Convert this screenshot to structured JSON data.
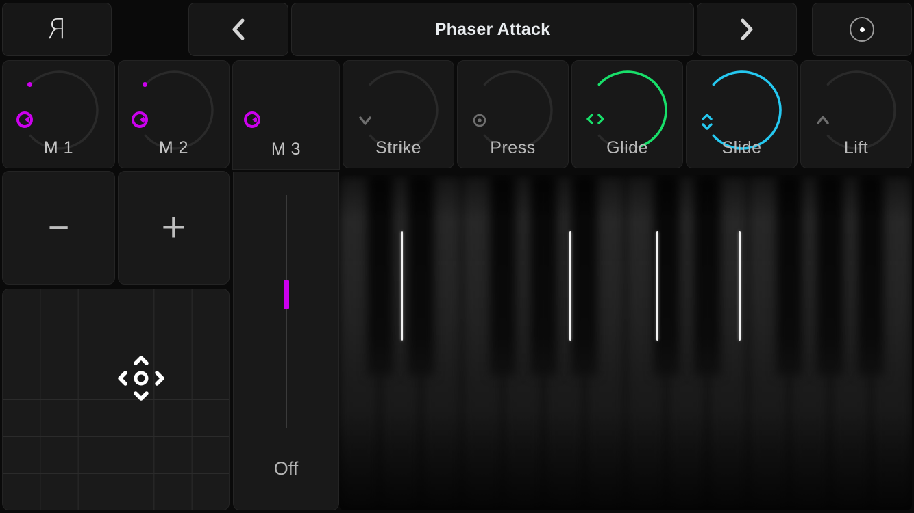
{
  "header": {
    "logo": "R",
    "logo_icon": "roli-logo-icon",
    "prev_label": "‹",
    "prev_icon": "chevron-left-icon",
    "title": "Phaser Attack",
    "next_label": "›",
    "next_icon": "chevron-right-icon",
    "record_icon": "record-circle-icon"
  },
  "knobs": [
    {
      "id": "macro-1",
      "label": "M 1",
      "icon": "knob-dial-icon",
      "color": "#cc00ee",
      "value": 0,
      "arc_color": "#2e2e2e",
      "has_arc": true,
      "has_start_dot": true
    },
    {
      "id": "macro-2",
      "label": "M 2",
      "icon": "knob-dial-icon",
      "color": "#cc00ee",
      "value": 0,
      "arc_color": "#2e2e2e",
      "has_arc": true,
      "has_start_dot": true
    },
    {
      "id": "macro-3",
      "label": "M 3",
      "icon": "knob-dial-icon",
      "color": "#cc00ee",
      "value": 0,
      "arc_color": "#2e2e2e",
      "has_arc": false,
      "has_start_dot": false
    },
    {
      "id": "strike",
      "label": "Strike",
      "icon": "chevron-down-icon",
      "color": "#6e6e6e",
      "value": 0,
      "arc_color": "#262626",
      "has_arc": true,
      "has_start_dot": false
    },
    {
      "id": "press",
      "label": "Press",
      "icon": "circle-dot-icon",
      "color": "#6e6e6e",
      "value": 0,
      "arc_color": "#262626",
      "has_arc": true,
      "has_start_dot": false
    },
    {
      "id": "glide",
      "label": "Glide",
      "icon": "chevron-left-right-icon",
      "color": "#18e06a",
      "value": 75,
      "arc_color": "#18e06a",
      "has_arc": true,
      "has_start_dot": false
    },
    {
      "id": "slide",
      "label": "Slide",
      "icon": "chevron-up-down-icon",
      "color": "#25c8f0",
      "value": 100,
      "arc_color": "#25c8f0",
      "has_arc": true,
      "has_start_dot": false
    },
    {
      "id": "lift",
      "label": "Lift",
      "icon": "chevron-up-icon",
      "color": "#6e6e6e",
      "value": 0,
      "arc_color": "#262626",
      "has_arc": true,
      "has_start_dot": false
    }
  ],
  "transpose": {
    "decrement_label": "−",
    "decrement_icon": "minus-icon",
    "increment_label": "+",
    "increment_icon": "plus-icon"
  },
  "xy_pad": {
    "name": "xy-control-pad",
    "grid_columns": 6,
    "grid_rows": 6,
    "dpad_icon": "dpad-icon",
    "dpad_center_icon": "circle-outline-icon",
    "dpad_up_icon": "chevron-up-icon",
    "dpad_down_icon": "chevron-down-icon",
    "dpad_left_icon": "chevron-left-icon",
    "dpad_right_icon": "chevron-right-icon"
  },
  "slider": {
    "name": "macro-3-slider",
    "value_label": "Off",
    "position_percent": 42,
    "thumb_color": "#cc00ee",
    "track_color": "#3a3a3a"
  },
  "keyboard": {
    "name": "piano-keyboard-visualizer",
    "note_marker_positions": [
      10.8,
      40.2,
      55.4,
      69.7
    ],
    "marker_color": "#f2f2f2",
    "white_key_count": 14,
    "black_key_pattern": [
      1,
      1,
      0,
      1,
      1,
      1,
      0
    ]
  },
  "colors": {
    "background": "#0a0a0a",
    "panel": "#181818",
    "panel_border": "#242424",
    "text": "#b9b9b9",
    "accent_macro": "#cc00ee",
    "accent_glide": "#18e06a",
    "accent_slide": "#25c8f0"
  }
}
